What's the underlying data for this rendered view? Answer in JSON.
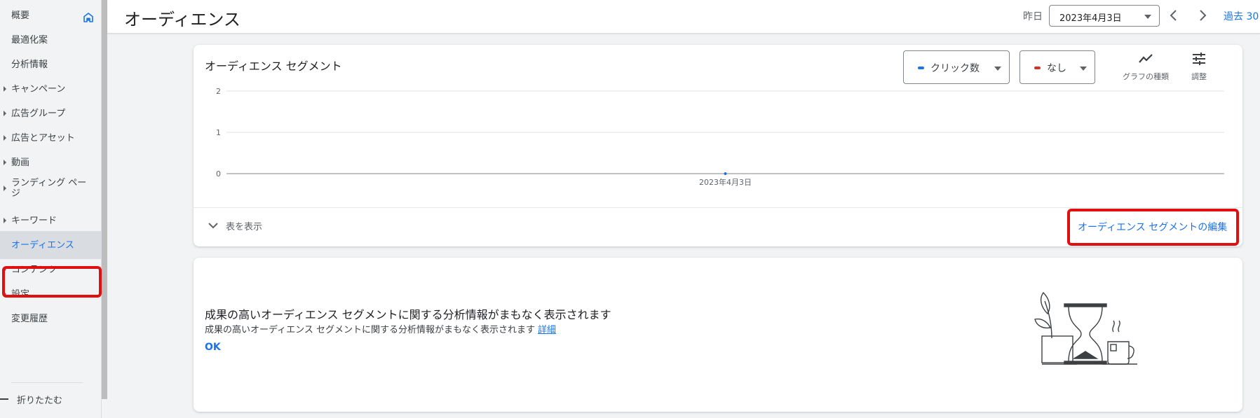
{
  "sidebar": {
    "items": [
      {
        "label": "概要",
        "caret": false
      },
      {
        "label": "最適化案",
        "caret": false
      },
      {
        "label": "分析情報",
        "caret": false
      },
      {
        "label": "キャンペーン",
        "caret": true
      },
      {
        "label": "広告グループ",
        "caret": true
      },
      {
        "label": "広告とアセット",
        "caret": true
      },
      {
        "label": "動画",
        "caret": true
      },
      {
        "label": "ランディング ペー\nジ",
        "caret": true
      },
      {
        "label": "キーワード",
        "caret": true
      },
      {
        "label": "オーディエンス",
        "caret": false,
        "active": true
      },
      {
        "label": "コンテンツ",
        "caret": true
      },
      {
        "label": "設定",
        "caret": true
      },
      {
        "label": "変更履歴",
        "caret": false
      }
    ],
    "collapse_label": "折りたたむ"
  },
  "header": {
    "title": "オーディエンス",
    "date_label": "昨日",
    "date_value": "2023年4月3日",
    "period_label": "過去 30"
  },
  "segment_card": {
    "title": "オーディエンス セグメント",
    "metric1": {
      "label": "クリック数",
      "color": "#1a73e8"
    },
    "metric2": {
      "label": "なし",
      "color": "#d93025"
    },
    "graph_type_label": "グラフの種類",
    "adjust_label": "調整",
    "show_table_label": "表を表示",
    "edit_link": "オーディエンス セグメントの編集"
  },
  "chart_data": {
    "type": "line",
    "x": [
      "2023年4月3日"
    ],
    "series": [
      {
        "values": [
          0
        ]
      }
    ],
    "y_ticks": [
      "2",
      "1",
      "0"
    ],
    "ylim": [
      0,
      2
    ],
    "grid": true
  },
  "insight_card": {
    "title": "成果の高いオーディエンス セグメントに関する分析情報がまもなく表示されます",
    "body": "成果の高いオーディエンス セグメントに関する分析情報がまもなく表示されます",
    "link": "詳細",
    "ok_label": "OK"
  },
  "colors": {
    "accent": "#1a73e8",
    "highlight": "#e01010"
  }
}
